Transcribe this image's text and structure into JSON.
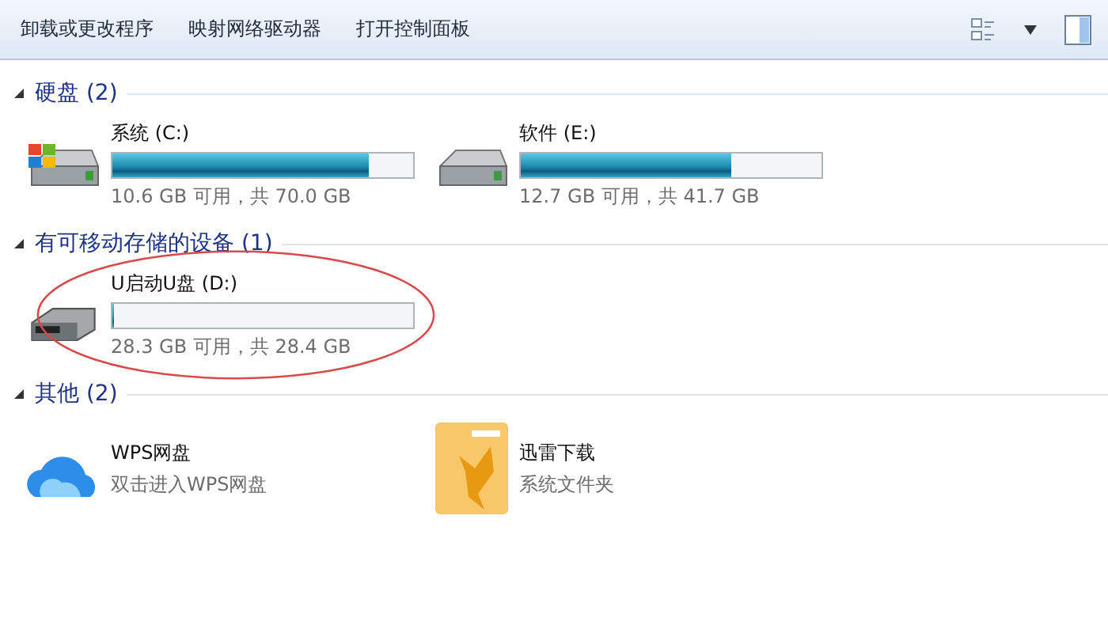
{
  "toolbar": {
    "buttons": [
      "卸载或更改程序",
      "映射网络驱动器",
      "打开控制面板"
    ]
  },
  "groups": [
    {
      "title": "硬盘 (2)",
      "expanded": true,
      "items": [
        {
          "kind": "system",
          "name": "系统 (C:)",
          "level": 0.85,
          "info": "10.6 GB 可用，共 70.0 GB",
          "circled": false
        },
        {
          "kind": "disk",
          "name": "软件 (E:)",
          "level": 0.7,
          "info": "12.7 GB 可用，共 41.7 GB",
          "circled": false
        }
      ]
    },
    {
      "title": "有可移动存储的设备 (1)",
      "expanded": true,
      "items": [
        {
          "kind": "usb",
          "name": "U启动U盘 (D:)",
          "level": 0.004,
          "info": "28.3 GB 可用，共 28.4 GB",
          "circled": true
        }
      ]
    },
    {
      "title": "其他 (2)",
      "expanded": true,
      "items": [
        {
          "kind": "cloud",
          "name": "WPS网盘",
          "info": "双击进入WPS网盘"
        },
        {
          "kind": "folder",
          "name": "迅雷下载",
          "info": "系统文件夹"
        }
      ]
    }
  ]
}
